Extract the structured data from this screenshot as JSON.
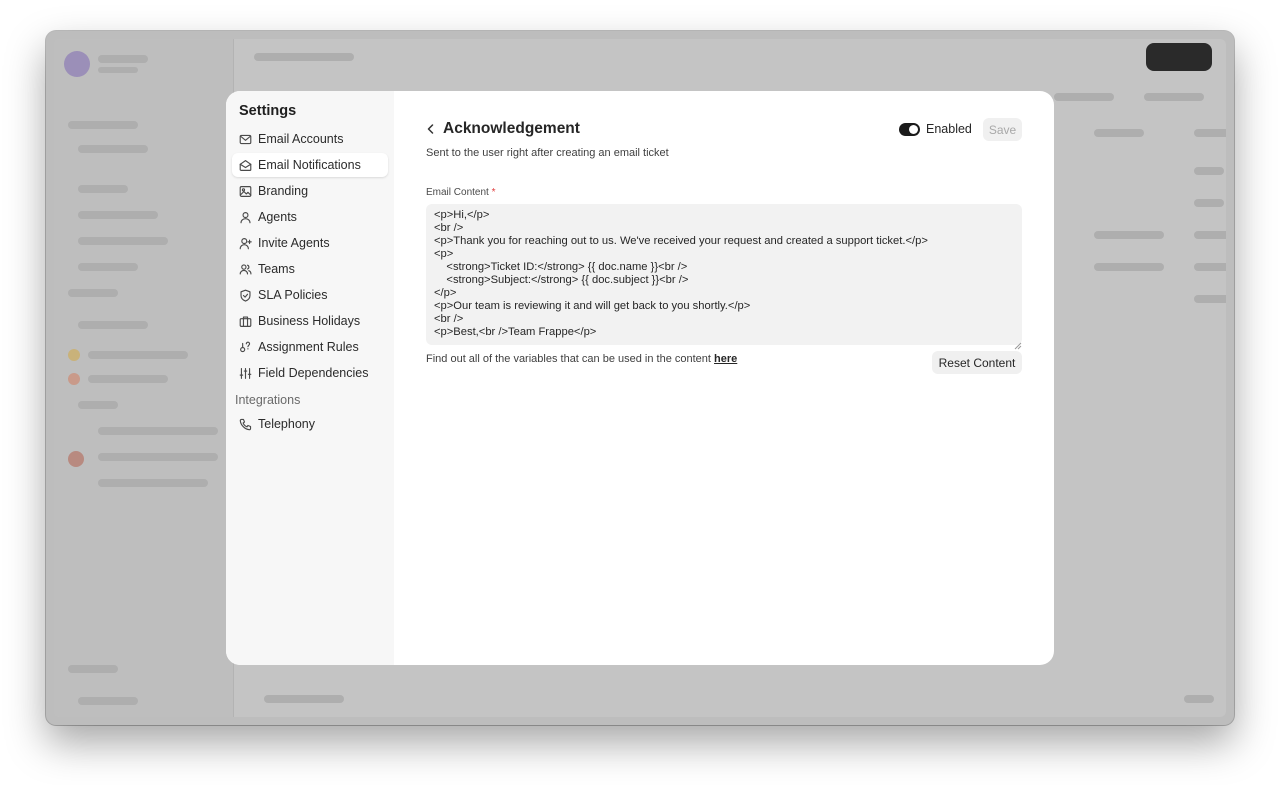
{
  "settings": {
    "title": "Settings",
    "nav": [
      {
        "label": "Email Accounts",
        "icon": "mail-icon"
      },
      {
        "label": "Email Notifications",
        "icon": "mail-open-icon",
        "active": true
      },
      {
        "label": "Branding",
        "icon": "image-icon"
      },
      {
        "label": "Agents",
        "icon": "user-icon"
      },
      {
        "label": "Invite Agents",
        "icon": "user-plus-icon"
      },
      {
        "label": "Teams",
        "icon": "users-icon"
      },
      {
        "label": "SLA Policies",
        "icon": "shield-icon"
      },
      {
        "label": "Business Holidays",
        "icon": "briefcase-icon"
      },
      {
        "label": "Assignment Rules",
        "icon": "assignment-icon"
      },
      {
        "label": "Field Dependencies",
        "icon": "sliders-icon"
      }
    ],
    "section_integrations": "Integrations",
    "integrations": [
      {
        "label": "Telephony",
        "icon": "phone-icon"
      }
    ]
  },
  "notification": {
    "title": "Acknowledgement",
    "subtitle": "Sent to the user right after creating an email ticket",
    "enabled_label": "Enabled",
    "enabled": true,
    "save_label": "Save",
    "field_label": "Email Content",
    "required_mark": "*",
    "content": "<p>Hi,</p>\n<br />\n<p>Thank you for reaching out to us. We've received your request and created a support ticket.</p>\n<p>\n    <strong>Ticket ID:</strong> {{ doc.name }}<br />\n    <strong>Subject:</strong> {{ doc.subject }}<br />\n</p>\n<p>Our team is reviewing it and will get back to you shortly.</p>\n<br />\n<p>Best,<br />Team Frappe</p>",
    "help_text": "Find out all of the variables that can be used in the content ",
    "help_link": "here",
    "reset_label": "Reset Content"
  }
}
